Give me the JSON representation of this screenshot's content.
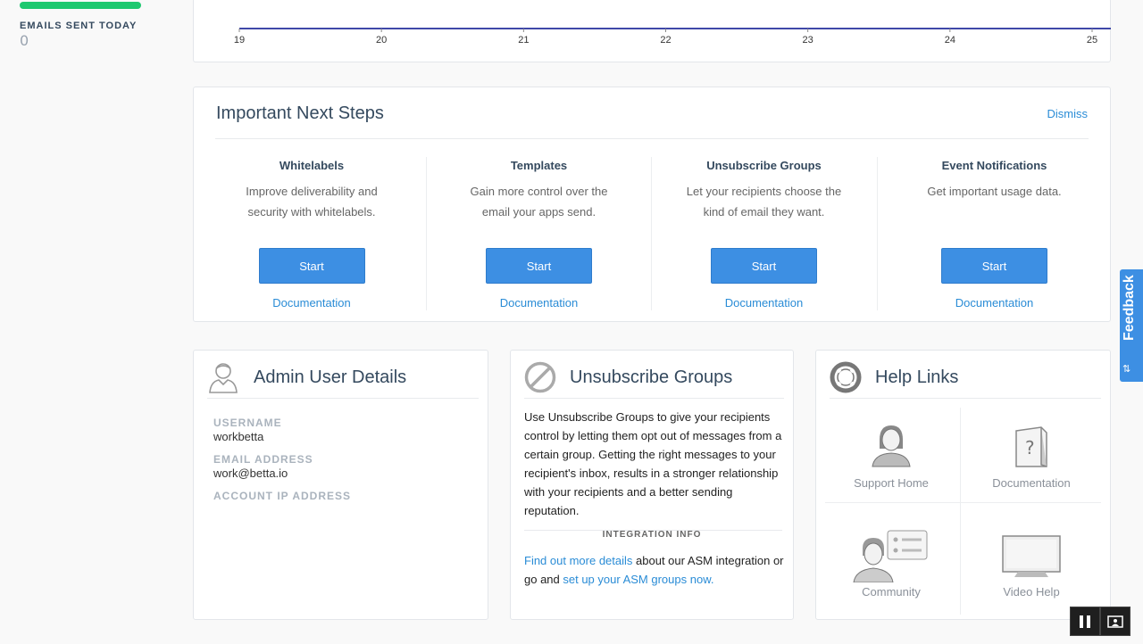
{
  "sidebar": {
    "stat_label": "EMAILS SENT TODAY",
    "stat_value": "0"
  },
  "chart": {
    "x_ticks": [
      "19",
      "20",
      "21",
      "22",
      "23",
      "24",
      "25"
    ],
    "line_color": "#3f48a8"
  },
  "next_steps": {
    "title": "Important Next Steps",
    "dismiss": "Dismiss",
    "steps": [
      {
        "title": "Whitelabels",
        "desc_1": "Improve deliverability and",
        "desc_2": "security with whitelabels.",
        "button": "Start",
        "link": "Documentation"
      },
      {
        "title": "Templates",
        "desc_1": "Gain more control over the",
        "desc_2": "email your apps send.",
        "button": "Start",
        "link": "Documentation"
      },
      {
        "title": "Unsubscribe Groups",
        "desc_1": "Let your recipients choose the",
        "desc_2": "kind of email they want.",
        "button": "Start",
        "link": "Documentation"
      },
      {
        "title": "Event Notifications",
        "desc_1": "Get important usage data.",
        "desc_2": "",
        "button": "Start",
        "link": "Documentation"
      }
    ]
  },
  "admin": {
    "title": "Admin User Details",
    "username_label": "USERNAME",
    "username": "workbetta",
    "email_label": "EMAIL ADDRESS",
    "email": "work@betta.io",
    "ip_label": "ACCOUNT IP ADDRESS"
  },
  "unsub": {
    "title": "Unsubscribe Groups",
    "body": "Use Unsubscribe Groups to give your recipients control by letting them opt out of messages from a certain group. Getting the right messages to your recipient's inbox, results in a stronger relationship with your recipients and a better sending reputation.",
    "integration_label": "INTEGRATION INFO",
    "int_link_1": "Find out more details",
    "int_text_1": " about our ASM integration or go and ",
    "int_link_2": "set up your ASM groups now."
  },
  "help": {
    "title": "Help Links",
    "items": [
      "Support Home",
      "Documentation",
      "Community",
      "Video Help"
    ]
  },
  "feedback": {
    "label": "Feedback"
  },
  "colors": {
    "accent": "#3d8fe3",
    "progress": "#1ec86f",
    "link": "#2a8cd6"
  }
}
